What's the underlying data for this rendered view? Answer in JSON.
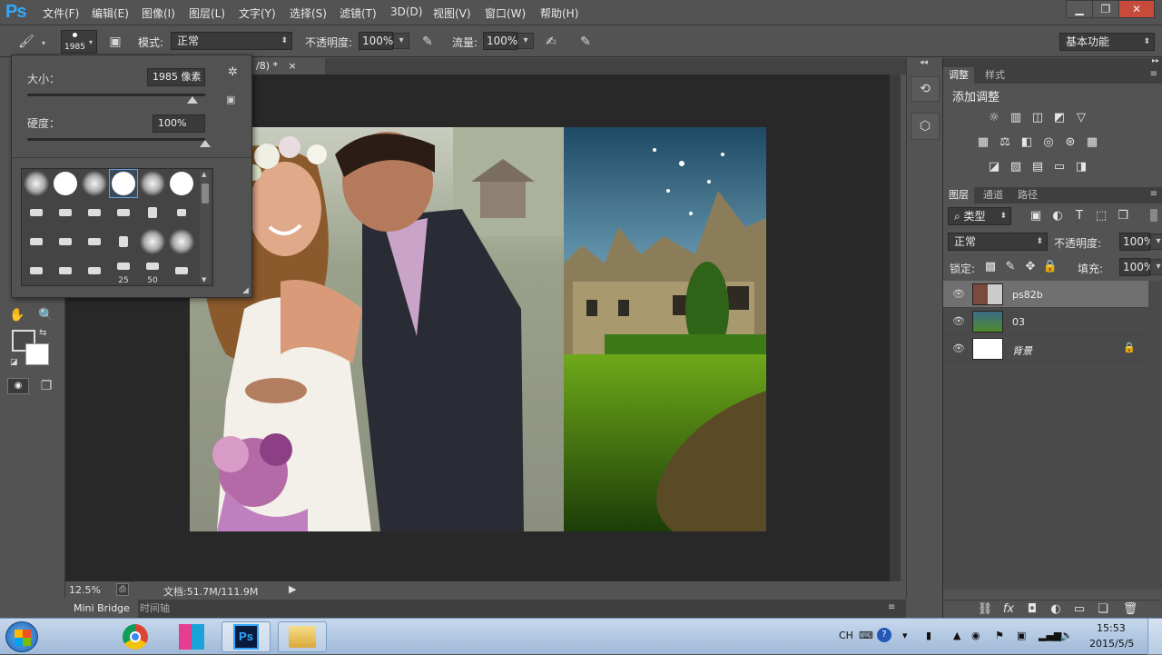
{
  "app": {
    "logo": "Ps"
  },
  "menu": [
    "文件(F)",
    "编辑(E)",
    "图像(I)",
    "图层(L)",
    "文字(Y)",
    "选择(S)",
    "滤镜(T)",
    "3D(D)",
    "视图(V)",
    "窗口(W)",
    "帮助(H)"
  ],
  "window_controls": {
    "minimize": "▁",
    "restore": "❐",
    "close": "✕"
  },
  "options": {
    "brush_size": "1985",
    "mode_label": "模式:",
    "mode_value": "正常",
    "opacity_label": "不透明度:",
    "opacity_value": "100%",
    "flow_label": "流量:",
    "flow_value": "100%",
    "workspace": "基本功能"
  },
  "brush_panel": {
    "size_label": "大小：",
    "size_value": "1985 像素",
    "hardness_label": "硬度：",
    "hardness_value": "100%",
    "size_level": 0.93,
    "hardness_level": 1.0,
    "label_25": "25",
    "label_50": "50"
  },
  "document": {
    "tab_title": "/8) *",
    "tab_close": "×",
    "zoom": "12.5%",
    "doc_info": "文档:51.7M/111.9M"
  },
  "bottom_tabs": [
    "Mini Bridge",
    "时间轴"
  ],
  "adjustments_panel": {
    "tabs": [
      "调整",
      "样式"
    ],
    "title": "添加调整",
    "icons_row1": [
      "brightness-icon",
      "levels-icon",
      "curves-icon",
      "exposure-icon",
      "vibrance-icon"
    ],
    "icons_row2": [
      "hue-icon",
      "balance-icon",
      "bw-icon",
      "photo-filter-icon",
      "channel-mixer-icon",
      "lookup-icon"
    ],
    "icons_row3": [
      "invert-icon",
      "posterize-icon",
      "threshold-icon",
      "gradient-map-icon"
    ]
  },
  "layers_panel": {
    "tabs": [
      "图层",
      "通道",
      "路径"
    ],
    "filter_kind": "类型",
    "blend_mode": "正常",
    "opacity_label": "不透明度:",
    "opacity_value": "100%",
    "lock_label": "锁定:",
    "fill_label": "填充:",
    "fill_value": "100%",
    "layers": [
      {
        "name": "ps82b",
        "selected": true
      },
      {
        "name": "03",
        "selected": false
      },
      {
        "name": "背景",
        "selected": false,
        "locked": true
      }
    ]
  },
  "taskbar": {
    "tray_lang": "CH",
    "time": "15:53",
    "date": "2015/5/5"
  }
}
